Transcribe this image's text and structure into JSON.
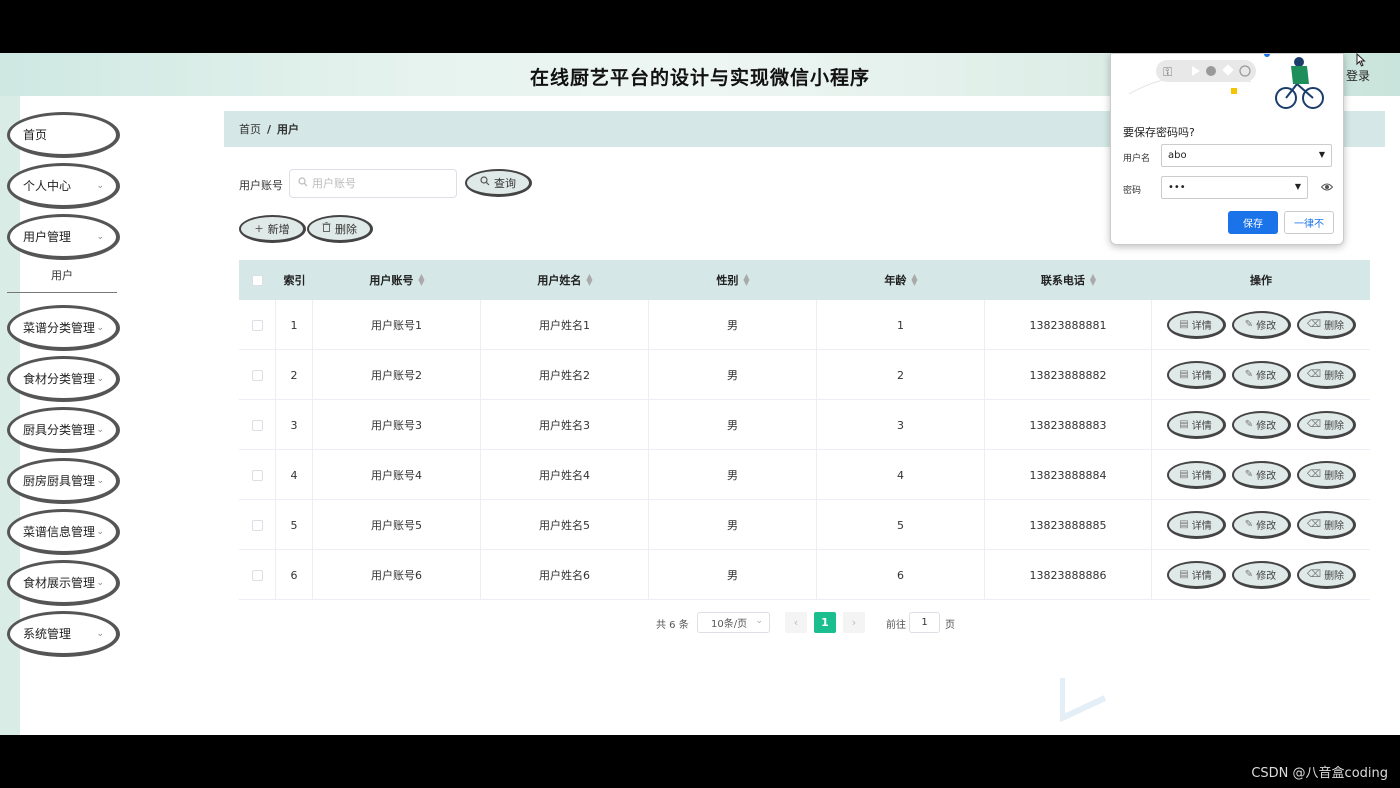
{
  "header": {
    "title": "在线厨艺平台的设计与实现微信小程序",
    "login_label": "登录"
  },
  "sidebar": {
    "items": [
      {
        "label": "首页",
        "has_children": false
      },
      {
        "label": "个人中心",
        "has_children": true
      },
      {
        "label": "用户管理",
        "has_children": true
      },
      {
        "label": "菜谱分类管理",
        "has_children": true
      },
      {
        "label": "食材分类管理",
        "has_children": true
      },
      {
        "label": "厨具分类管理",
        "has_children": true
      },
      {
        "label": "厨房厨具管理",
        "has_children": true
      },
      {
        "label": "菜谱信息管理",
        "has_children": true
      },
      {
        "label": "食材展示管理",
        "has_children": true
      },
      {
        "label": "系统管理",
        "has_children": true
      }
    ],
    "active_submenu": "用户"
  },
  "breadcrumb": {
    "home": "首页",
    "separator": "/",
    "current": "用户"
  },
  "search": {
    "label": "用户账号",
    "placeholder": "用户账号",
    "value": "",
    "button_label": "查询"
  },
  "toolbar": {
    "add_label": "新增",
    "delete_label": "删除"
  },
  "table": {
    "headers": {
      "index": "索引",
      "account": "用户账号",
      "name": "用户姓名",
      "gender": "性别",
      "age": "年龄",
      "phone": "联系电话",
      "actions": "操作"
    },
    "action_labels": {
      "detail": "详情",
      "edit": "修改",
      "delete": "删除"
    },
    "rows": [
      {
        "index": "1",
        "account": "用户账号1",
        "name": "用户姓名1",
        "gender": "男",
        "age": "1",
        "phone": "13823888881"
      },
      {
        "index": "2",
        "account": "用户账号2",
        "name": "用户姓名2",
        "gender": "男",
        "age": "2",
        "phone": "13823888882"
      },
      {
        "index": "3",
        "account": "用户账号3",
        "name": "用户姓名3",
        "gender": "男",
        "age": "3",
        "phone": "13823888883"
      },
      {
        "index": "4",
        "account": "用户账号4",
        "name": "用户姓名4",
        "gender": "男",
        "age": "4",
        "phone": "13823888884"
      },
      {
        "index": "5",
        "account": "用户账号5",
        "name": "用户姓名5",
        "gender": "男",
        "age": "5",
        "phone": "13823888885"
      },
      {
        "index": "6",
        "account": "用户账号6",
        "name": "用户姓名6",
        "gender": "男",
        "age": "6",
        "phone": "13823888886"
      }
    ]
  },
  "pagination": {
    "total_label": "共 6 条",
    "page_size_label": "10条/页",
    "current_page": "1",
    "goto_label": "前往",
    "goto_value": "1",
    "page_suffix": "页"
  },
  "password_popup": {
    "title": "要保存密码吗?",
    "username_label": "用户名",
    "username_value": "abo",
    "password_label": "密码",
    "password_value": "•••",
    "save_label": "保存",
    "never_label": "一律不"
  },
  "watermark": "CSDN @八音盒coding",
  "colors": {
    "accent": "#1bbf8f",
    "header_bg": "#d5e8e7",
    "browser_blue": "#1a73e8"
  }
}
